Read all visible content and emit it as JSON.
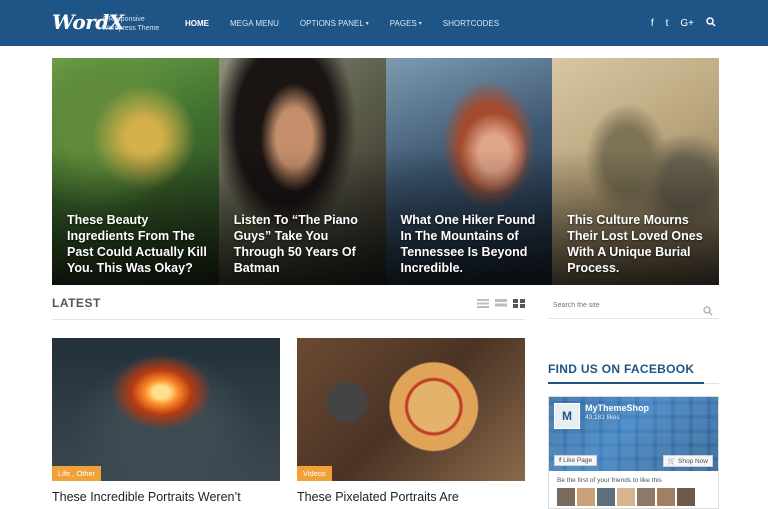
{
  "site": {
    "logo": "WordX",
    "tagline": "A Responsive Wordpress Theme"
  },
  "nav": {
    "items": [
      {
        "label": "HOME",
        "active": true,
        "dropdown": false
      },
      {
        "label": "MEGA MENU",
        "active": false,
        "dropdown": false
      },
      {
        "label": "OPTIONS PANEL",
        "active": false,
        "dropdown": true
      },
      {
        "label": "PAGES",
        "active": false,
        "dropdown": true
      },
      {
        "label": "SHORTCODES",
        "active": false,
        "dropdown": false
      }
    ],
    "social": [
      "facebook-icon",
      "twitter-icon",
      "google-plus-icon",
      "search-icon"
    ],
    "social_glyphs": [
      "f",
      "t",
      "G+",
      "⌕"
    ]
  },
  "featured": [
    {
      "title": "These Beauty Ingredients From The Past Could Actually Kill You. This Was Okay?"
    },
    {
      "title": "Listen To “The Piano Guys” Take You Through 50 Years Of Batman"
    },
    {
      "title": "What One Hiker Found In The Mountains of Tennessee Is Beyond Incredible."
    },
    {
      "title": "This Culture Mourns Their Lost Loved Ones With A Unique Burial Process."
    }
  ],
  "latest": {
    "heading": "LATEST",
    "view_modes": [
      "list",
      "rows",
      "grid"
    ],
    "active_view": "grid",
    "posts": [
      {
        "category": "Life , Other",
        "title": "These Incredible Portraits Weren’t"
      },
      {
        "category": "Videos",
        "title": "These Pixelated Portraits Are"
      }
    ]
  },
  "sidebar": {
    "search_placeholder": "Search the site",
    "facebook_heading": "FIND US ON FACEBOOK",
    "fb_page_name": "MyThemeShop",
    "fb_likes": "43,181 likes",
    "fb_like_button": "Like Page",
    "fb_shop_button": "Shop Now",
    "fb_friends_text": "Be the first of your friends to like this"
  },
  "colors": {
    "header_bg": "#1f5586",
    "accent_orange": "#f0a13a",
    "facebook_blue": "#3b6fb0"
  }
}
